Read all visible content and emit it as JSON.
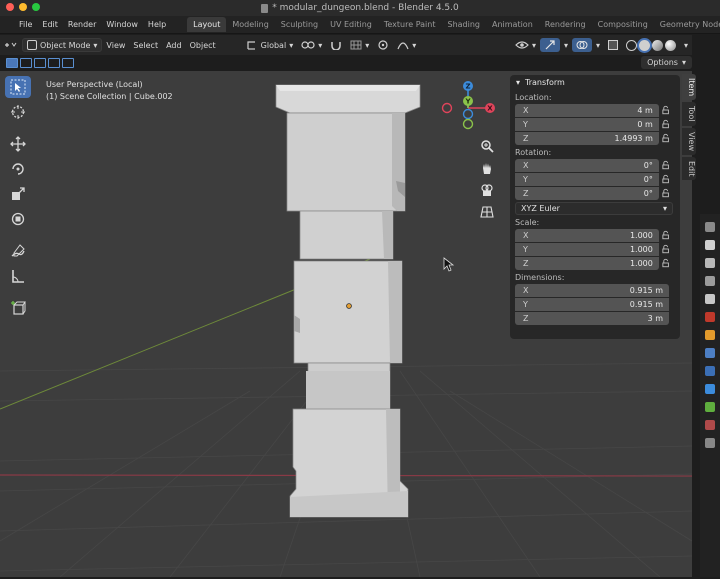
{
  "titlebar": {
    "title": "* modular_dungeon.blend - Blender 4.5.0"
  },
  "menu": {
    "items": [
      "File",
      "Edit",
      "Render",
      "Window",
      "Help"
    ]
  },
  "workspaces": {
    "tabs": [
      "Layout",
      "Modeling",
      "Sculpting",
      "UV Editing",
      "Texture Paint",
      "Shading",
      "Animation",
      "Rendering",
      "Compositing",
      "Geometry Nodes",
      "Sc"
    ],
    "active": "Layout"
  },
  "header": {
    "mode": "Object Mode",
    "view": "View",
    "select": "Select",
    "add": "Add",
    "object": "Object",
    "orientation": "Global",
    "options": "Options"
  },
  "viewport": {
    "perspective": "User Perspective (Local)",
    "collection": "(1) Scene Collection | Cube.002"
  },
  "gizmo": {
    "z": "Z",
    "y": "Y",
    "x": "X"
  },
  "npanel": {
    "title": "Transform",
    "location": {
      "label": "Location:",
      "x": "4 m",
      "y": "0 m",
      "z": "1.4993 m"
    },
    "rotation": {
      "label": "Rotation:",
      "x": "0°",
      "y": "0°",
      "z": "0°",
      "mode": "XYZ Euler"
    },
    "scale": {
      "label": "Scale:",
      "x": "1.000",
      "y": "1.000",
      "z": "1.000"
    },
    "dimensions": {
      "label": "Dimensions:",
      "x": "0.915 m",
      "y": "0.915 m",
      "z": "3 m"
    },
    "axis_labels": {
      "x": "X",
      "y": "Y",
      "z": "Z"
    }
  },
  "sidetabs": [
    "Item",
    "Tool",
    "View",
    "Edit"
  ],
  "colors": {
    "accent": "#4772b3",
    "axis_x": "#e0445b",
    "axis_y": "#8bc34a",
    "axis_z": "#3c8cdc",
    "object_origin": "#e6a034"
  }
}
